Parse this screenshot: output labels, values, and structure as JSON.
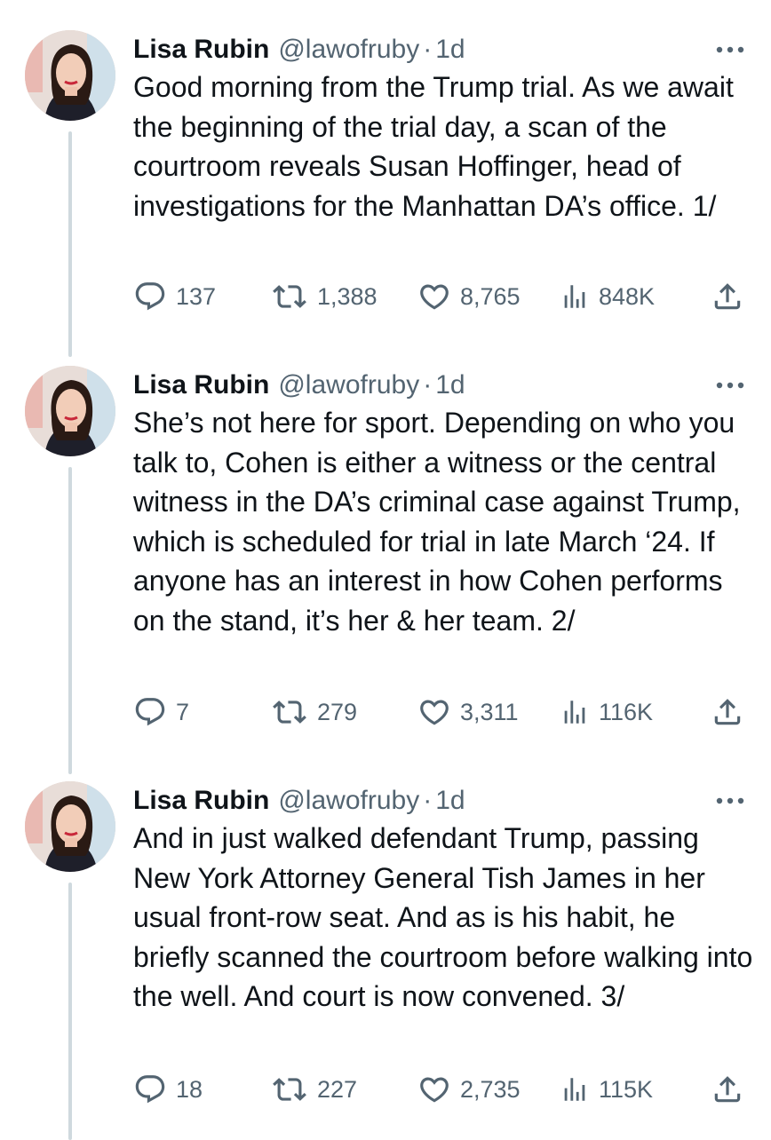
{
  "tweets": [
    {
      "author_name": "Lisa Rubin",
      "handle": "@lawofruby",
      "separator": "·",
      "time": "1d",
      "text": "Good morning from the Trump trial. As we await the beginning of the trial day, a scan of the courtroom reveals Susan Hoffinger, head of investigations for the Manhattan DA’s office. 1/",
      "replies": "137",
      "reposts": "1,388",
      "likes": "8,765",
      "views": "848K"
    },
    {
      "author_name": "Lisa Rubin",
      "handle": "@lawofruby",
      "separator": "·",
      "time": "1d",
      "text": "She’s not here for sport. Depending on who you talk to, Cohen is either a witness or the central witness in the DA’s criminal case against Trump, which is scheduled for trial in late March ‘24. If anyone has an interest in how Cohen performs on the stand, it’s her & her team. 2/",
      "replies": "7",
      "reposts": "279",
      "likes": "3,311",
      "views": "116K"
    },
    {
      "author_name": "Lisa Rubin",
      "handle": "@lawofruby",
      "separator": "·",
      "time": "1d",
      "text": "And in just walked defendant Trump, passing New York Attorney General Tish James in her usual front-row seat. And as is his habit, he briefly scanned the courtroom before walking into the well. And court is now convened. 3/",
      "replies": "18",
      "reposts": "227",
      "likes": "2,735",
      "views": "115K"
    }
  ],
  "icons": {
    "reply": "reply-icon",
    "repost": "repost-icon",
    "like": "heart-icon",
    "views": "views-icon",
    "share": "share-icon",
    "more": "more-icon"
  },
  "colors": {
    "text": "#0f1419",
    "secondary": "#536471",
    "thread_line": "#cfd9de"
  }
}
